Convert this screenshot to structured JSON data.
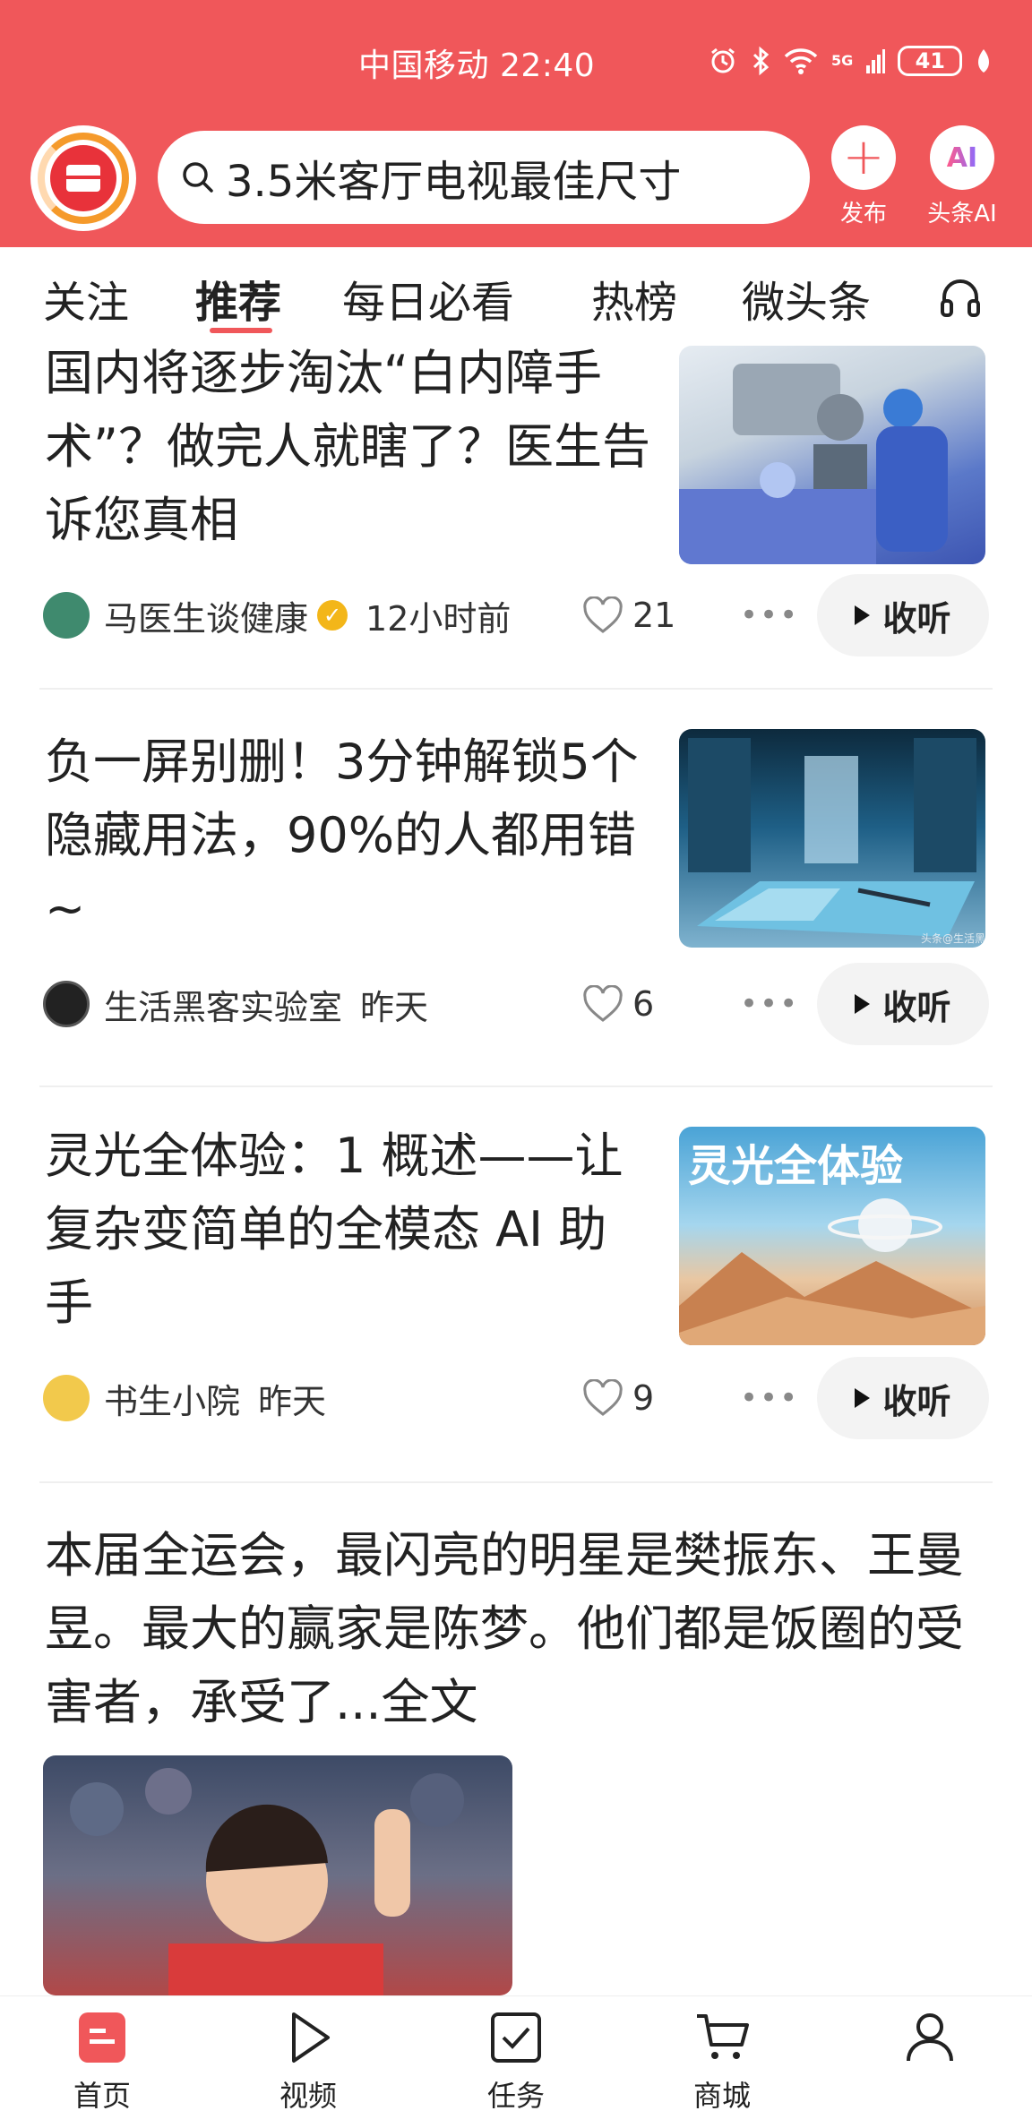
{
  "status_bar": {
    "carrier_time": "中国移动 22:40",
    "network": "5G",
    "battery": "41"
  },
  "header": {
    "search_text": "3.5米客厅电视最佳尺寸",
    "publish_label": "发布",
    "ai_icon_text": "AI",
    "ai_label": "头条AI"
  },
  "tabs": {
    "items": [
      "关注",
      "推荐",
      "每日必看",
      "热榜",
      "微头条"
    ],
    "active": "推荐"
  },
  "feed": [
    {
      "title": "国内将逐步淘汰“白内障手术”？做完人就瞎了？医生告诉您真相",
      "author": "马医生谈健康",
      "verified": true,
      "time": "12小时前",
      "likes": "21",
      "listen_label": "收听"
    },
    {
      "title": "负一屏别删！3分钟解锁5个隐藏用法，90%的人都用错 ~",
      "author": "生活黑客实验室",
      "time": "昨天",
      "likes": "6",
      "listen_label": "收听",
      "image_watermark": "头条@生活黑"
    },
    {
      "title": "灵光全体验：1 概述——让复杂变简单的全模态 AI 助手",
      "author": "书生小院",
      "time": "昨天",
      "likes": "9",
      "listen_label": "收听",
      "image_text": "灵光全体验"
    },
    {
      "title": "本届全运会，最闪亮的明星是樊振东、王曼昱。最大的赢家是陈梦。他们都是饭圈的受害者，承受了...全文"
    }
  ],
  "bottom_nav": {
    "items": [
      "首页",
      "视频",
      "任务",
      "商城",
      ""
    ],
    "active": "首页"
  },
  "colors": {
    "brand_red": "#f0575a",
    "accent_orange": "#f59a2b"
  }
}
